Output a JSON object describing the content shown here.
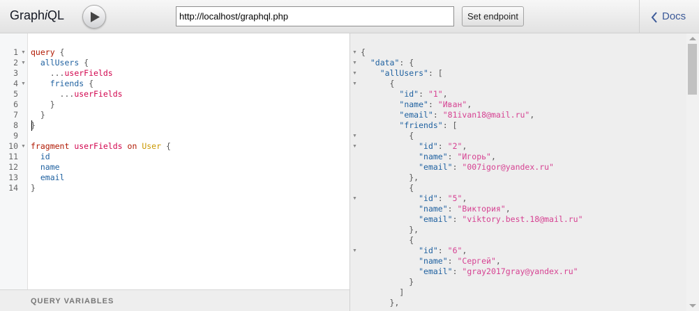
{
  "app": {
    "title_prefix": "Graph",
    "title_italic": "i",
    "title_suffix": "QL"
  },
  "toolbar": {
    "endpoint_value": "http://localhost/graphql.php",
    "set_endpoint_label": "Set endpoint",
    "docs_label": "Docs"
  },
  "variables": {
    "title": "QUERY VARIABLES"
  },
  "query_editor": {
    "line_numbers": [
      "1",
      "2",
      "3",
      "4",
      "5",
      "6",
      "7",
      "8",
      "9",
      "10",
      "11",
      "12",
      "13",
      "14"
    ],
    "lines": [
      [
        {
          "t": "query",
          "c": "kw"
        },
        {
          "t": " {",
          "c": "punct"
        }
      ],
      [
        {
          "t": "  ",
          "c": "punct"
        },
        {
          "t": "allUsers",
          "c": "prop"
        },
        {
          "t": " {",
          "c": "punct"
        }
      ],
      [
        {
          "t": "    ...",
          "c": "punct"
        },
        {
          "t": "userFields",
          "c": "def"
        }
      ],
      [
        {
          "t": "    ",
          "c": "punct"
        },
        {
          "t": "friends",
          "c": "prop"
        },
        {
          "t": " {",
          "c": "punct"
        }
      ],
      [
        {
          "t": "      ...",
          "c": "punct"
        },
        {
          "t": "userFields",
          "c": "def"
        }
      ],
      [
        {
          "t": "    }",
          "c": "punct"
        }
      ],
      [
        {
          "t": "  }",
          "c": "punct"
        }
      ],
      [
        {
          "t": "}",
          "c": "punct"
        }
      ],
      [],
      [
        {
          "t": "fragment",
          "c": "kw"
        },
        {
          "t": " ",
          "c": "punct"
        },
        {
          "t": "userFields",
          "c": "def"
        },
        {
          "t": " ",
          "c": "punct"
        },
        {
          "t": "on",
          "c": "kw"
        },
        {
          "t": " ",
          "c": "punct"
        },
        {
          "t": "User",
          "c": "type"
        },
        {
          "t": " {",
          "c": "punct"
        }
      ],
      [
        {
          "t": "  ",
          "c": "punct"
        },
        {
          "t": "id",
          "c": "prop"
        }
      ],
      [
        {
          "t": "  ",
          "c": "punct"
        },
        {
          "t": "name",
          "c": "prop"
        }
      ],
      [
        {
          "t": "  ",
          "c": "punct"
        },
        {
          "t": "email",
          "c": "prop"
        }
      ],
      [
        {
          "t": "}",
          "c": "punct"
        }
      ]
    ],
    "fold_lines": [
      1,
      2,
      4,
      10
    ]
  },
  "result_viewer": {
    "lines": [
      [
        {
          "t": "{",
          "c": "rpunct"
        }
      ],
      [
        {
          "t": "  ",
          "c": "rpunct"
        },
        {
          "t": "\"data\"",
          "c": "attr"
        },
        {
          "t": ": {",
          "c": "rpunct"
        }
      ],
      [
        {
          "t": "    ",
          "c": "rpunct"
        },
        {
          "t": "\"allUsers\"",
          "c": "attr"
        },
        {
          "t": ": [",
          "c": "rpunct"
        }
      ],
      [
        {
          "t": "      {",
          "c": "rpunct"
        }
      ],
      [
        {
          "t": "        ",
          "c": "rpunct"
        },
        {
          "t": "\"id\"",
          "c": "attr"
        },
        {
          "t": ": ",
          "c": "rpunct"
        },
        {
          "t": "\"1\"",
          "c": "str"
        },
        {
          "t": ",",
          "c": "rpunct"
        }
      ],
      [
        {
          "t": "        ",
          "c": "rpunct"
        },
        {
          "t": "\"name\"",
          "c": "attr"
        },
        {
          "t": ": ",
          "c": "rpunct"
        },
        {
          "t": "\"Иван\"",
          "c": "str"
        },
        {
          "t": ",",
          "c": "rpunct"
        }
      ],
      [
        {
          "t": "        ",
          "c": "rpunct"
        },
        {
          "t": "\"email\"",
          "c": "attr"
        },
        {
          "t": ": ",
          "c": "rpunct"
        },
        {
          "t": "\"81ivan18@mail.ru\"",
          "c": "str"
        },
        {
          "t": ",",
          "c": "rpunct"
        }
      ],
      [
        {
          "t": "        ",
          "c": "rpunct"
        },
        {
          "t": "\"friends\"",
          "c": "attr"
        },
        {
          "t": ": [",
          "c": "rpunct"
        }
      ],
      [
        {
          "t": "          {",
          "c": "rpunct"
        }
      ],
      [
        {
          "t": "            ",
          "c": "rpunct"
        },
        {
          "t": "\"id\"",
          "c": "attr"
        },
        {
          "t": ": ",
          "c": "rpunct"
        },
        {
          "t": "\"2\"",
          "c": "str"
        },
        {
          "t": ",",
          "c": "rpunct"
        }
      ],
      [
        {
          "t": "            ",
          "c": "rpunct"
        },
        {
          "t": "\"name\"",
          "c": "attr"
        },
        {
          "t": ": ",
          "c": "rpunct"
        },
        {
          "t": "\"Игорь\"",
          "c": "str"
        },
        {
          "t": ",",
          "c": "rpunct"
        }
      ],
      [
        {
          "t": "            ",
          "c": "rpunct"
        },
        {
          "t": "\"email\"",
          "c": "attr"
        },
        {
          "t": ": ",
          "c": "rpunct"
        },
        {
          "t": "\"007igor@yandex.ru\"",
          "c": "str"
        }
      ],
      [
        {
          "t": "          },",
          "c": "rpunct"
        }
      ],
      [
        {
          "t": "          {",
          "c": "rpunct"
        }
      ],
      [
        {
          "t": "            ",
          "c": "rpunct"
        },
        {
          "t": "\"id\"",
          "c": "attr"
        },
        {
          "t": ": ",
          "c": "rpunct"
        },
        {
          "t": "\"5\"",
          "c": "str"
        },
        {
          "t": ",",
          "c": "rpunct"
        }
      ],
      [
        {
          "t": "            ",
          "c": "rpunct"
        },
        {
          "t": "\"name\"",
          "c": "attr"
        },
        {
          "t": ": ",
          "c": "rpunct"
        },
        {
          "t": "\"Виктория\"",
          "c": "str"
        },
        {
          "t": ",",
          "c": "rpunct"
        }
      ],
      [
        {
          "t": "            ",
          "c": "rpunct"
        },
        {
          "t": "\"email\"",
          "c": "attr"
        },
        {
          "t": ": ",
          "c": "rpunct"
        },
        {
          "t": "\"viktory.best.18@mail.ru\"",
          "c": "str"
        }
      ],
      [
        {
          "t": "          },",
          "c": "rpunct"
        }
      ],
      [
        {
          "t": "          {",
          "c": "rpunct"
        }
      ],
      [
        {
          "t": "            ",
          "c": "rpunct"
        },
        {
          "t": "\"id\"",
          "c": "attr"
        },
        {
          "t": ": ",
          "c": "rpunct"
        },
        {
          "t": "\"6\"",
          "c": "str"
        },
        {
          "t": ",",
          "c": "rpunct"
        }
      ],
      [
        {
          "t": "            ",
          "c": "rpunct"
        },
        {
          "t": "\"name\"",
          "c": "attr"
        },
        {
          "t": ": ",
          "c": "rpunct"
        },
        {
          "t": "\"Сергей\"",
          "c": "str"
        },
        {
          "t": ",",
          "c": "rpunct"
        }
      ],
      [
        {
          "t": "            ",
          "c": "rpunct"
        },
        {
          "t": "\"email\"",
          "c": "attr"
        },
        {
          "t": ": ",
          "c": "rpunct"
        },
        {
          "t": "\"gray2017gray@yandex.ru\"",
          "c": "str"
        }
      ],
      [
        {
          "t": "          }",
          "c": "rpunct"
        }
      ],
      [
        {
          "t": "        ]",
          "c": "rpunct"
        }
      ],
      [
        {
          "t": "      },",
          "c": "rpunct"
        }
      ]
    ],
    "fold_lines": [
      1,
      2,
      3,
      4,
      9,
      10,
      15,
      20
    ]
  }
}
